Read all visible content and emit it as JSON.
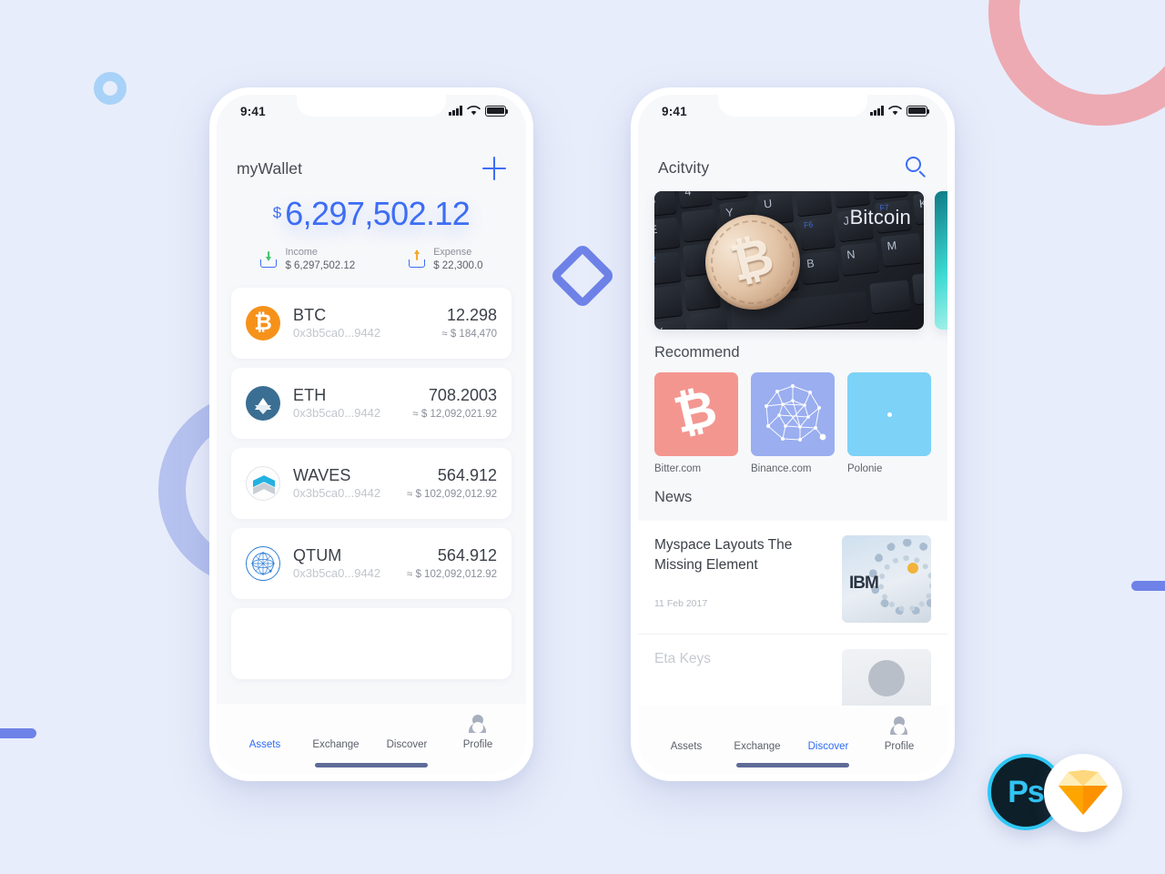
{
  "background": {
    "page_color": "#e8edfb",
    "decorations": [
      {
        "name": "pink-arc",
        "color": "#edaab3"
      },
      {
        "name": "blue-donut",
        "color": "#a8d2f7"
      },
      {
        "name": "purple-ring",
        "color": "#b6c2ef"
      },
      {
        "name": "diamond-outline",
        "color": "#6e82e8"
      },
      {
        "name": "bar-left",
        "color": "#6e82e8"
      },
      {
        "name": "bar-right",
        "color": "#6e82e8"
      }
    ]
  },
  "accent": {
    "blue": "#3d6df5",
    "tab_active": "#2f6bf5",
    "income_green": "#3ec46d",
    "expense_orange": "#f5a623"
  },
  "wallet_screen": {
    "statusbar": {
      "time": "9:41",
      "signal_icon": "cellular-bars-icon",
      "wifi_icon": "wifi-icon",
      "battery_icon": "battery-icon"
    },
    "header": {
      "title": "myWallet",
      "add_icon": "plus-icon"
    },
    "balance": {
      "currency_symbol": "$",
      "amount": "6,297,502.12",
      "income": {
        "label": "Income",
        "value": "$ 6,297,502.12",
        "icon": "download-tray-icon"
      },
      "expense": {
        "label": "Expense",
        "value": "$ 22,300.0",
        "icon": "upload-tray-icon"
      }
    },
    "assets": [
      {
        "icon": "bitcoin-icon",
        "symbol": "BTC",
        "address": "0x3b5ca0...9442",
        "amount": "12.298",
        "fiat": "≈ $ 184,470"
      },
      {
        "icon": "ethereum-icon",
        "symbol": "ETH",
        "address": "0x3b5ca0...9442",
        "amount": "708.2003",
        "fiat": "≈ $ 12,092,021.92"
      },
      {
        "icon": "waves-icon",
        "symbol": "WAVES",
        "address": "0x3b5ca0...9442",
        "amount": "564.912",
        "fiat": "≈ $ 102,092,012.92"
      },
      {
        "icon": "qtum-icon",
        "symbol": "QTUM",
        "address": "0x3b5ca0...9442",
        "amount": "564.912",
        "fiat": "≈ $ 102,092,012.92"
      }
    ],
    "tabs": [
      {
        "label": "Assets",
        "icon": "diamond-icon",
        "active": true
      },
      {
        "label": "Exchange",
        "icon": "waves-circle-icon",
        "active": false
      },
      {
        "label": "Discover",
        "icon": "compass-icon",
        "active": false
      },
      {
        "label": "Profile",
        "icon": "person-icon",
        "active": false
      }
    ]
  },
  "discover_screen": {
    "statusbar": {
      "time": "9:41",
      "signal_icon": "cellular-bars-icon",
      "wifi_icon": "wifi-icon",
      "battery_icon": "battery-icon"
    },
    "header": {
      "title": "Acitvity",
      "search_icon": "search-icon"
    },
    "hero_cards": [
      {
        "label": "Bitcoin",
        "image": "bitcoin-coin-on-keyboard"
      },
      {
        "label": "",
        "image": "teal-abstract"
      }
    ],
    "recommend": {
      "title": "Recommend",
      "items": [
        {
          "caption": "Bitter.com",
          "color": "#f49690",
          "icon": "bitcoin-b-icon"
        },
        {
          "caption": "Binance.com",
          "color": "#9aaef0",
          "icon": "network-polygon-icon"
        },
        {
          "caption": "Polonie",
          "color": "#7dd2f7",
          "icon": "dot-icon"
        }
      ]
    },
    "news": {
      "title": "News",
      "items": [
        {
          "title": "Myspace Layouts The Missing Element",
          "date": "11 Feb 2017",
          "thumb": "ibm-server-icon"
        },
        {
          "title": "Eta Keys",
          "date": "",
          "thumb": "person-avatar-icon"
        }
      ]
    },
    "tabs": [
      {
        "label": "Assets",
        "icon": "diamond-icon",
        "active": false
      },
      {
        "label": "Exchange",
        "icon": "waves-circle-icon",
        "active": false
      },
      {
        "label": "Discover",
        "icon": "compass-icon",
        "active": true
      },
      {
        "label": "Profile",
        "icon": "person-icon",
        "active": false
      }
    ]
  },
  "logos": [
    {
      "name": "photoshop-logo",
      "text": "Ps"
    },
    {
      "name": "sketch-logo",
      "text": ""
    }
  ]
}
